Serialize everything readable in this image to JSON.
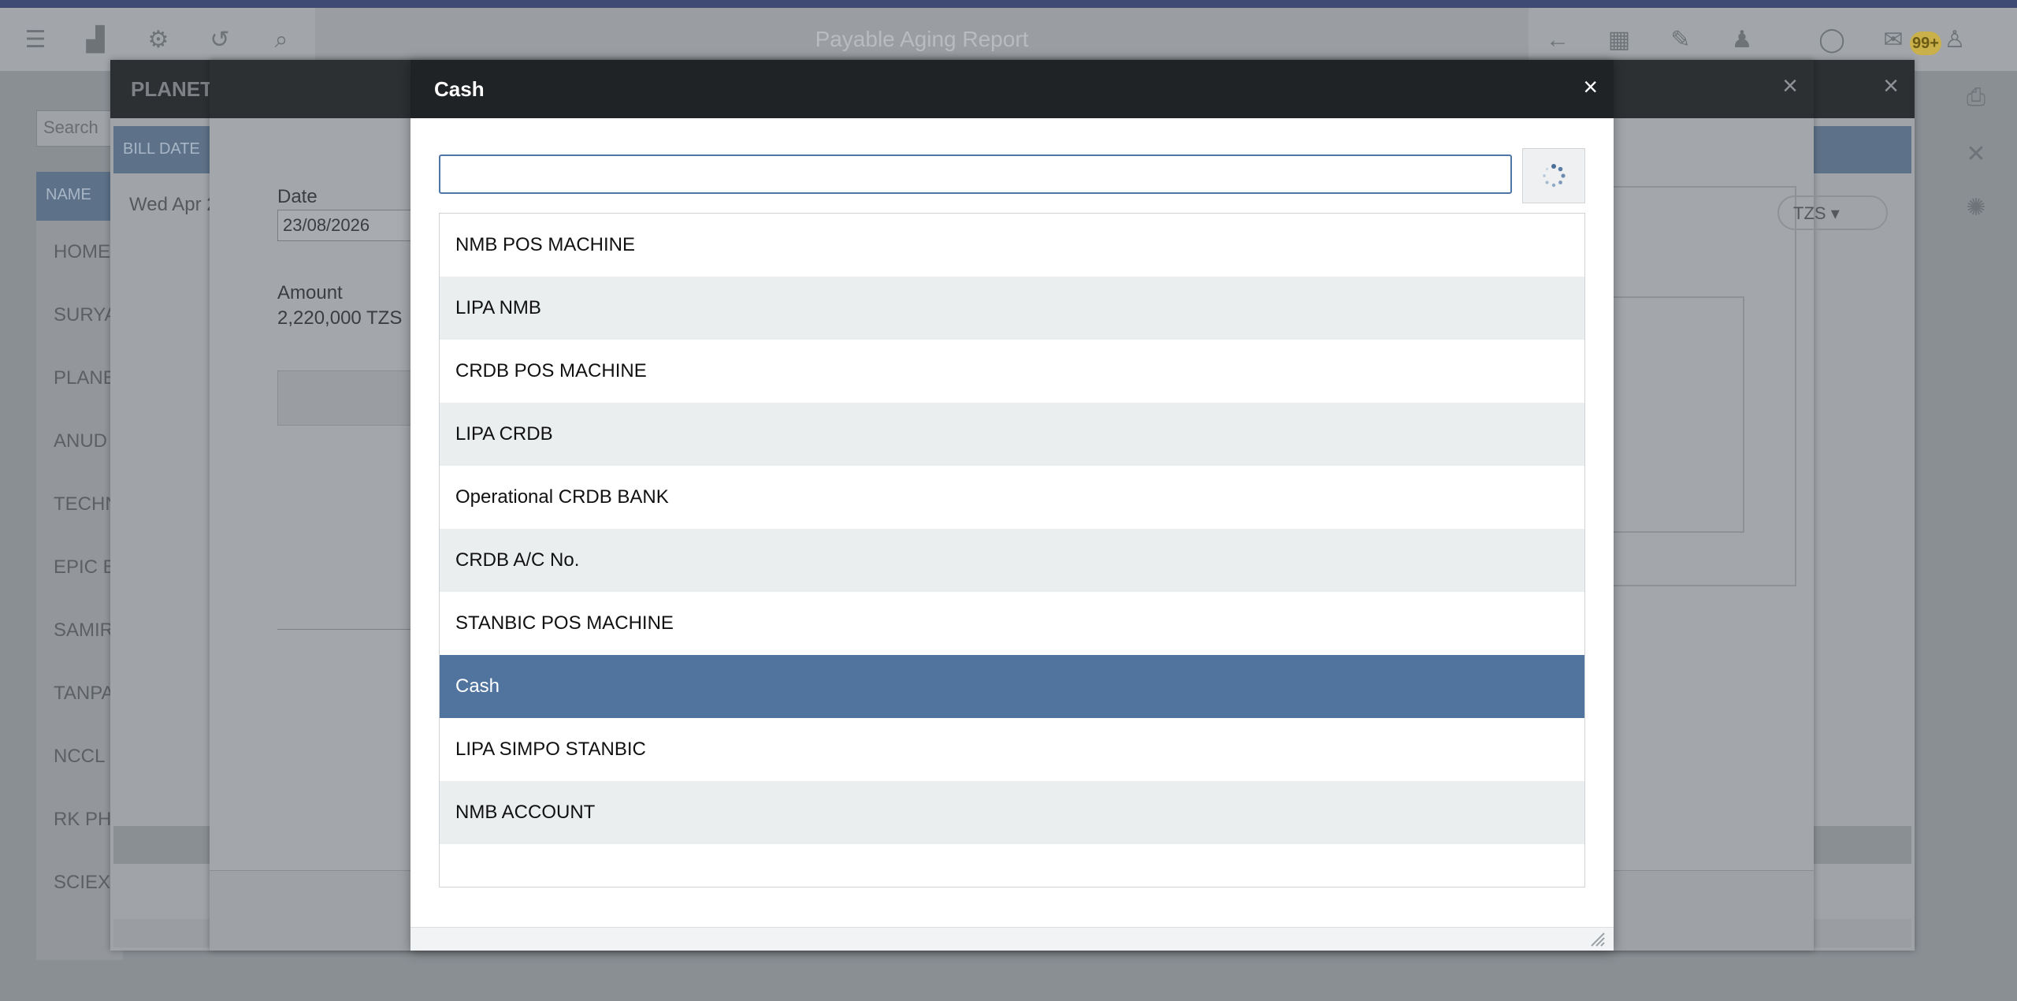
{
  "app": {
    "title": "Payable Aging Report",
    "notification_count": "99+"
  },
  "background": {
    "search_placeholder": "Search",
    "name_header": "NAME",
    "list_items": [
      "HOME",
      "SURYA",
      "PLANE",
      "ANUD",
      "TECHN",
      "EPIC B",
      "SAMIR",
      "TANPA",
      "NCCL",
      "RK PH",
      "SCIEX"
    ]
  },
  "parent_modal": {
    "title": "PLANET",
    "bill_date_header": "BILL DATE",
    "bill_date_value": "Wed Apr 2"
  },
  "payment_modal": {
    "date_label": "Date",
    "date_value": "23/08/2026",
    "amount_label": "Amount",
    "amount_value": "2,220,000 TZS",
    "currency_select": "TZS"
  },
  "dialog": {
    "title": "Cash",
    "close_label": "×",
    "search_value": "",
    "search_placeholder": "",
    "items": [
      "NMB POS MACHINE",
      "LIPA NMB",
      "CRDB POS MACHINE",
      "LIPA CRDB",
      "Operational CRDB BANK",
      "CRDB A/C No.",
      "STANBIC POS MACHINE",
      "Cash",
      "LIPA SIMPO STANBIC",
      "NMB ACCOUNT"
    ],
    "selected_item": "Cash"
  },
  "colors": {
    "header": "#1f2326",
    "selected_row": "#50749e",
    "alt_row": "#ebeeef",
    "search_border": "#4f76a6"
  }
}
